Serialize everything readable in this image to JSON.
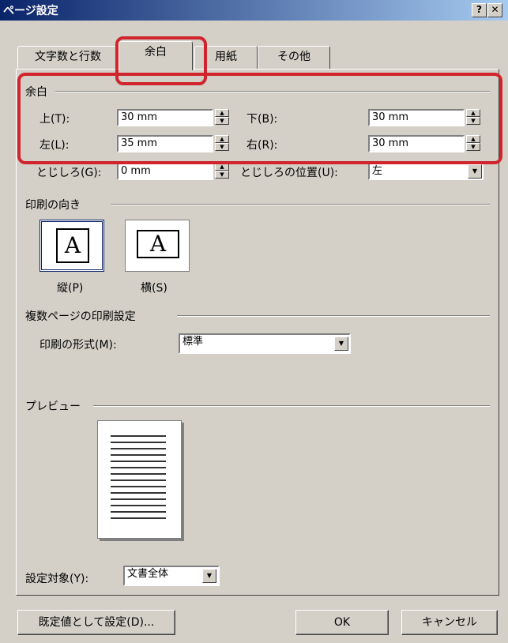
{
  "window": {
    "title": "ページ設定",
    "help_btn": "?",
    "close_btn": "✕"
  },
  "tabs": [
    {
      "label": "文字数と行数"
    },
    {
      "label": "余白"
    },
    {
      "label": "用紙"
    },
    {
      "label": "その他"
    }
  ],
  "margins": {
    "group_label": "余白",
    "top_label": "上(T):",
    "top_value": "30 mm",
    "bottom_label": "下(B):",
    "bottom_value": "30 mm",
    "left_label": "左(L):",
    "left_value": "35 mm",
    "right_label": "右(R):",
    "right_value": "30 mm",
    "gutter_label": "とじしろ(G):",
    "gutter_value": "0 mm",
    "gutter_pos_label": "とじしろの位置(U):",
    "gutter_pos_value": "左"
  },
  "orientation": {
    "group_label": "印刷の向き",
    "portrait_label": "縦(P)",
    "landscape_label": "横(S)",
    "icon_letter": "A"
  },
  "multi_page": {
    "group_label": "複数ページの印刷設定",
    "format_label": "印刷の形式(M):",
    "format_value": "標準"
  },
  "preview": {
    "group_label": "プレビュー"
  },
  "apply": {
    "label": "設定対象(Y):",
    "value": "文書全体"
  },
  "buttons": {
    "default": "既定値として設定(D)...",
    "ok": "OK",
    "cancel": "キャンセル"
  },
  "colors": {
    "highlight": "#d0252c",
    "titlebar": "#0a246a"
  }
}
